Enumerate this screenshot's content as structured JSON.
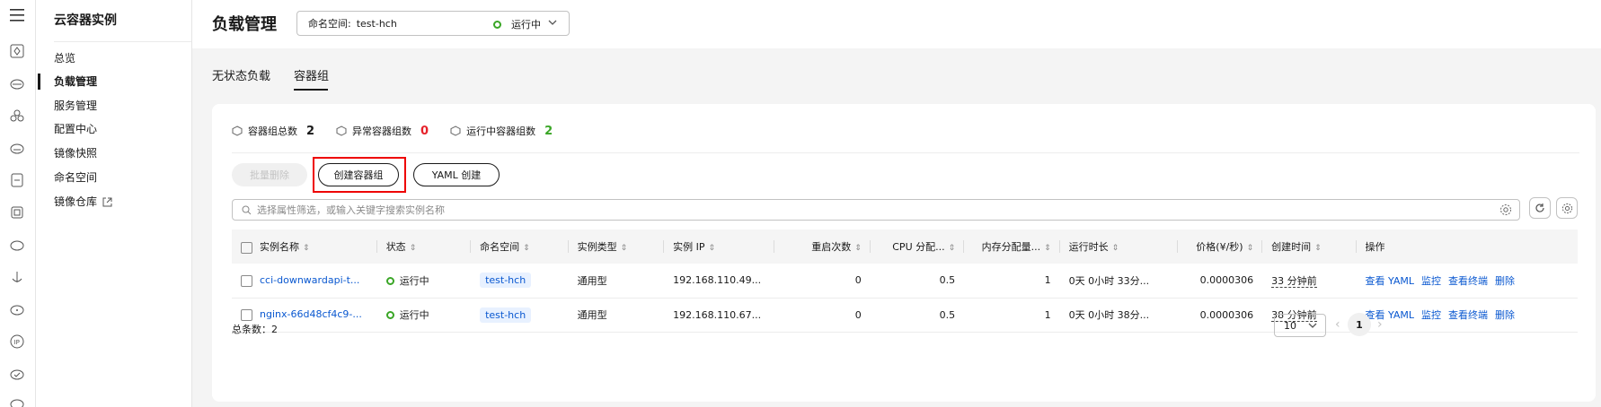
{
  "sidebar": {
    "title": "云容器实例",
    "items": [
      {
        "label": "总览"
      },
      {
        "label": "负载管理"
      },
      {
        "label": "服务管理"
      },
      {
        "label": "配置中心"
      },
      {
        "label": "镜像快照"
      },
      {
        "label": "命名空间"
      },
      {
        "label": "镜像仓库"
      }
    ]
  },
  "header": {
    "title": "负载管理",
    "namespace_label": "命名空间:",
    "namespace_value": "test-hch",
    "namespace_status": "运行中"
  },
  "tabs": [
    {
      "label": "无状态负载"
    },
    {
      "label": "容器组"
    }
  ],
  "stats": [
    {
      "label": "容器组总数",
      "value": "2",
      "color": "#191919"
    },
    {
      "label": "异常容器组数",
      "value": "0",
      "color": "#e6212a"
    },
    {
      "label": "运行中容器组数",
      "value": "2",
      "color": "#3aa626"
    }
  ],
  "toolbar": {
    "batch_delete": "批量删除",
    "create_pod": "创建容器组",
    "yaml_create": "YAML 创建"
  },
  "search": {
    "placeholder": "选择属性筛选，或输入关键字搜索实例名称"
  },
  "table": {
    "columns": [
      "实例名称",
      "状态",
      "命名空间",
      "实例类型",
      "实例 IP",
      "重启次数",
      "CPU 分配...",
      "内存分配量...",
      "运行时长",
      "价格(¥/秒)",
      "创建时间",
      "操作"
    ],
    "rows": [
      {
        "name": "cci-downwardapi-t...",
        "status": "运行中",
        "namespace": "test-hch",
        "type": "通用型",
        "ip": "192.168.110.49...",
        "restarts": "0",
        "cpu": "0.5",
        "mem": "1",
        "uptime": "0天 0小时 33分...",
        "price": "0.0000306",
        "created": "33 分钟前",
        "ops": [
          "查看 YAML",
          "监控",
          "查看终端",
          "删除"
        ]
      },
      {
        "name": "nginx-66d48cf4c9-...",
        "status": "运行中",
        "namespace": "test-hch",
        "type": "通用型",
        "ip": "192.168.110.67...",
        "restarts": "0",
        "cpu": "0.5",
        "mem": "1",
        "uptime": "0天 0小时 38分...",
        "price": "0.0000306",
        "created": "38 分钟前",
        "ops": [
          "查看 YAML",
          "监控",
          "查看终端",
          "删除"
        ]
      }
    ]
  },
  "footer": {
    "total": "总条数：2",
    "page_size": "10",
    "current_page": "1"
  }
}
